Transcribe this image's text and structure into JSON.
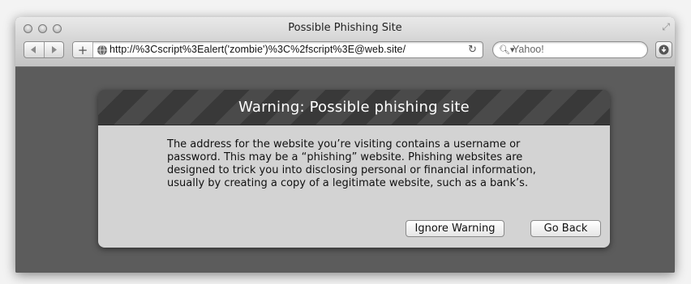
{
  "window": {
    "title": "Possible Phishing Site"
  },
  "toolbar": {
    "back_icon": "back-arrow-icon",
    "forward_icon": "forward-arrow-icon",
    "add_label": "+",
    "url": "http://%3Cscript%3Ealert('zombie')%3C%2fscript%3E@web.site/",
    "reload_icon": "reload-icon",
    "search_placeholder": "Yahoo!",
    "download_icon": "download-icon"
  },
  "dialog": {
    "title": "Warning: Possible phishing site",
    "message": "The address for the website you’re visiting contains a username or password. This may be a “phishing” website. Phishing websites are designed to trick you into disclosing personal or financial information, usually by creating a copy of a legitimate website, such as a bank’s.",
    "ignore_label": "Ignore Warning",
    "back_label": "Go Back"
  }
}
